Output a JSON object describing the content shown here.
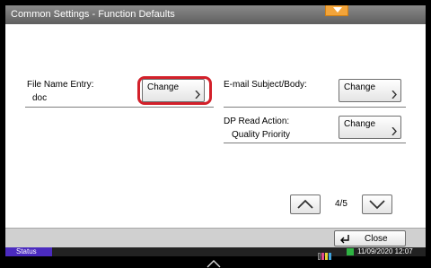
{
  "window": {
    "title": "Common Settings - Function Defaults"
  },
  "fields": {
    "file_name_entry": {
      "label": "File Name Entry:",
      "value": "doc",
      "button": "Change"
    },
    "email_subject": {
      "label": "E-mail Subject/Body:",
      "button": "Change"
    },
    "dp_read_action": {
      "label": "DP Read Action:",
      "value": "Quality Priority",
      "button": "Change"
    }
  },
  "pagination": {
    "current": "4",
    "total": "5",
    "text": "4/5"
  },
  "footer": {
    "close_label": "Close"
  },
  "status": {
    "tab_label": "Status",
    "datetime": "11/09/2020  12:07"
  },
  "icons": {
    "title_tab": "chevron-down-icon",
    "button_arrow": "chevron-right-icon",
    "page_up": "chevron-up-icon",
    "page_down": "chevron-down-icon",
    "close": "return-arrow-icon",
    "home": "home-icon"
  },
  "colors": {
    "highlight": "#d3202a",
    "title_tab": "#f2a43a",
    "status_tab": "#4b2bbf",
    "status_indicator": "#2fb343",
    "toner": [
      "#222222",
      "#e34b8c",
      "#e6d234",
      "#3fa2dd"
    ]
  }
}
